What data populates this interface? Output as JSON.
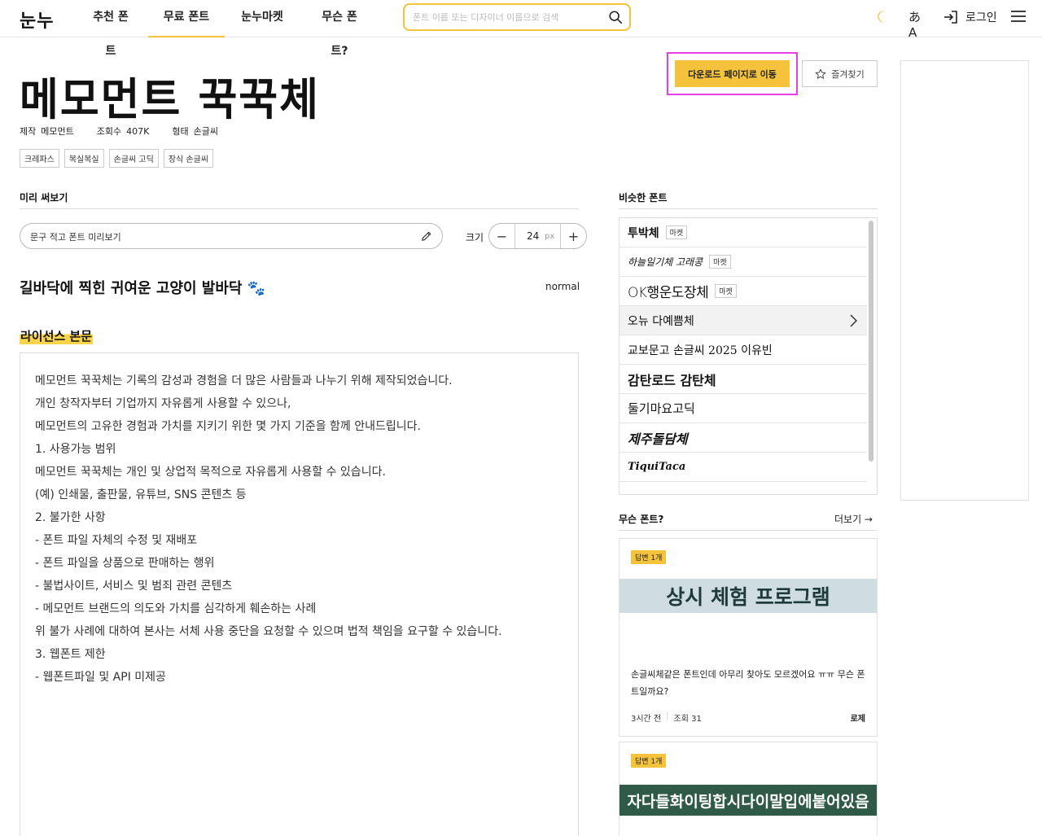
{
  "nav": {
    "logo": "눈누",
    "items": [
      "추천 폰트",
      "무료 폰트",
      "눈누마켓",
      "무슨 폰트?"
    ],
    "active_index": 1,
    "search_placeholder": "폰트 이름 또는 디자이너 이름으로 검색",
    "login_label": "로그인",
    "translate_glyph": "あA"
  },
  "font": {
    "title": "메모먼트 꾹꾹체",
    "meta": [
      {
        "key": "제작",
        "value": "메모먼트"
      },
      {
        "key": "조회수",
        "value": "407K"
      },
      {
        "key": "형태",
        "value": "손글씨"
      }
    ],
    "tags": [
      "크레파스",
      "복실복실",
      "손글씨 고딕",
      "장식 손글씨"
    ],
    "download_label": "다운로드 페이지로 이동",
    "favorite_label": "즐겨찾기"
  },
  "preview": {
    "section_title": "미리 써보기",
    "input_placeholder": "문구 적고 폰트 미리보기",
    "size_label": "크기",
    "size_value": "24",
    "size_unit": "px",
    "sample_text": "길바닥에 찍힌 귀여운 고양이 발바닥 🐾",
    "weight": "normal"
  },
  "license": {
    "title": "라이선스 본문",
    "paragraphs": [
      "메모먼트 꾹꾹체는 기록의 감성과 경험을 더 많은 사람들과 나누기 위해 제작되었습니다.",
      "",
      "개인 창작자부터 기업까지 자유롭게 사용할 수 있으나,",
      "메모먼트의 고유한 경험과 가치를 지키기 위한 몇 가지 기준을 함께 안내드립니다.",
      "",
      "1. 사용가능 범위",
      "",
      "메모먼트 꾹꾹체는 개인 및 상업적 목적으로 자유롭게 사용할 수 있습니다.",
      "",
      "(예) 인쇄물, 출판물, 유튜브, SNS 콘텐츠 등",
      "",
      "2. 불가한 사항",
      "",
      "- 폰트 파일 자체의 수정 및 재배포",
      "- 폰트 파일을 상품으로 판매하는 행위",
      "- 불법사이트, 서비스 및 범죄 관련 콘텐츠",
      "- 메모먼트 브랜드의 의도와 가치를 심각하게 훼손하는 사례",
      "",
      "위 불가 사례에 대하여 본사는 서체 사용 중단을 요청할 수 있으며 법적 책임을 요구할 수 있습니다.",
      "",
      "3. 웹폰트 제한",
      "",
      "- 웹폰트파일 및 API 미제공"
    ]
  },
  "similar": {
    "section_title": "비슷한 폰트",
    "items": [
      {
        "name": "투박체",
        "badge": "마켓"
      },
      {
        "name": "하늘일기체 고래콩",
        "badge": "마켓"
      },
      {
        "name": "OK행운도장체",
        "badge": "마켓"
      },
      {
        "name": "오뉴 다예쁨체",
        "badge": ""
      },
      {
        "name": "교보문고 손글씨 2025 이유빈",
        "badge": ""
      },
      {
        "name": "감탄로드 감탄체",
        "badge": ""
      },
      {
        "name": "둘기마요고딕",
        "badge": ""
      },
      {
        "name": "제주돌담체",
        "badge": ""
      },
      {
        "name": "TiquiTaca",
        "badge": ""
      }
    ],
    "highlighted_index": 3
  },
  "qa": {
    "section_title": "무슨 폰트?",
    "more_label": "더보기 →",
    "cards": [
      {
        "badge": "답변 1개",
        "banner_text": "상시 체험 프로그램",
        "question": "손글씨체같은 폰트인데 아무리 찾아도 모르겠어요 ㅠㅠ 무슨 폰트일까요?",
        "time": "3시간 전",
        "views": "조회 31",
        "author": "로제"
      },
      {
        "badge": "답변 1개",
        "banner_text": "자다들화이팅합시다이말입에붙어있음"
      }
    ]
  },
  "colors": {
    "accent": "#f5c33b",
    "highlight_outline": "#e83ee6",
    "banner1_bg": "#cfdde1",
    "banner2_bg": "#2f5a48"
  }
}
